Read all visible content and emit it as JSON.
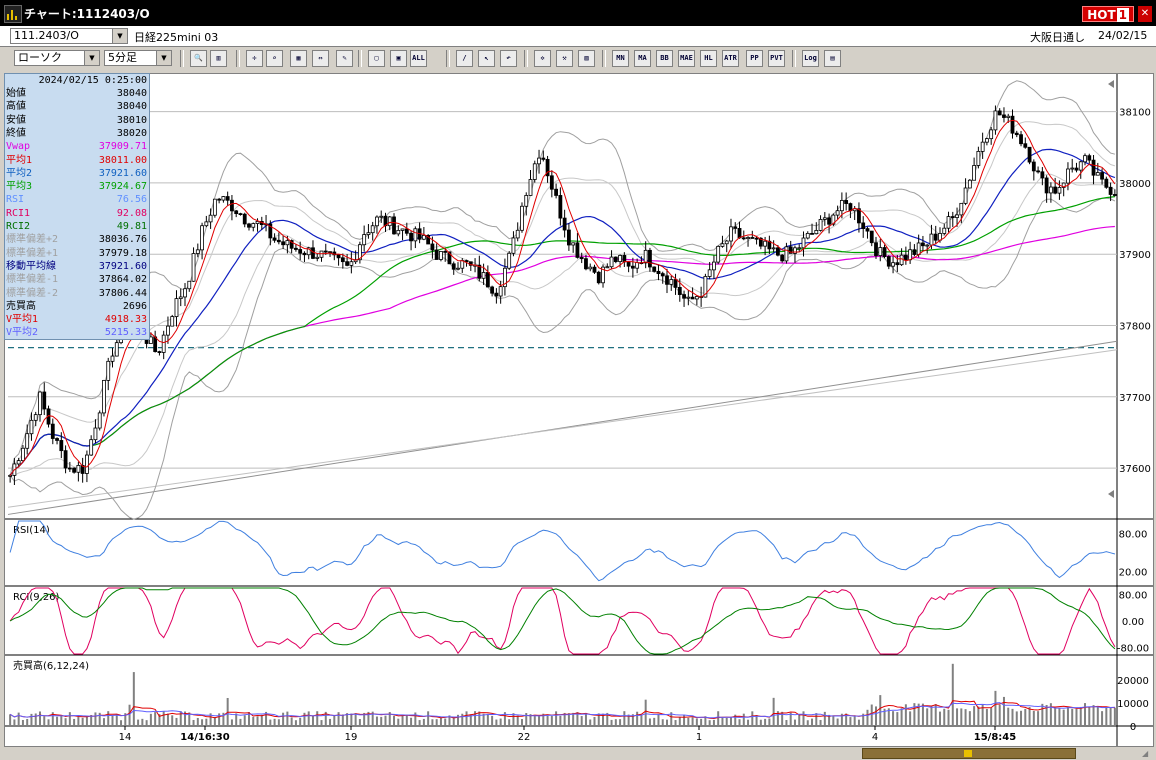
{
  "window": {
    "title": "チャート:1112403/O",
    "hot_label": "HOT",
    "hot_num": "1"
  },
  "header": {
    "symbol_code": "111.2403/O",
    "instrument_name": "日経225mini 03",
    "market": "大阪日通し",
    "date": "24/02/15"
  },
  "toolbar": {
    "chart_type": "ローソク",
    "period": "5分足",
    "buttons": [
      {
        "name": "zoom-icon",
        "glyph": "🔍"
      },
      {
        "name": "split-icon",
        "glyph": "▥"
      },
      {
        "name": "crosshair-icon",
        "glyph": "✛"
      },
      {
        "name": "magnify-icon",
        "glyph": "⌕"
      },
      {
        "name": "chart-icon",
        "glyph": "▦"
      },
      {
        "name": "scroll-icon",
        "glyph": "⇔"
      },
      {
        "name": "pen-icon",
        "glyph": "✎"
      },
      {
        "name": "pointer-icon",
        "glyph": "▢"
      },
      {
        "name": "grid-icon",
        "glyph": "▣"
      },
      {
        "name": "all-icon",
        "glyph": "ALL"
      },
      {
        "name": "pencil-icon",
        "glyph": "/"
      },
      {
        "name": "arrow-icon",
        "glyph": "↖"
      },
      {
        "name": "undo-icon",
        "glyph": "↶"
      },
      {
        "name": "star-icon",
        "glyph": "✲"
      },
      {
        "name": "wrench-icon",
        "glyph": "⚒"
      },
      {
        "name": "color-icon",
        "glyph": "▨"
      },
      {
        "name": "indicator-mn-icon",
        "glyph": "MN"
      },
      {
        "name": "indicator-ma-icon",
        "glyph": "MA"
      },
      {
        "name": "indicator-bb-icon",
        "glyph": "BB"
      },
      {
        "name": "indicator-mae-icon",
        "glyph": "MAE"
      },
      {
        "name": "indicator-hl-icon",
        "glyph": "HL"
      },
      {
        "name": "indicator-atr-icon",
        "glyph": "ATR"
      },
      {
        "name": "indicator-pp-icon",
        "glyph": "PP"
      },
      {
        "name": "indicator-pvt-icon",
        "glyph": "PVT"
      },
      {
        "name": "indicator-log-icon",
        "glyph": "Log"
      },
      {
        "name": "print-icon",
        "glyph": "▤"
      }
    ]
  },
  "info": {
    "datetime": "2024/02/15  0:25:00",
    "rows": [
      {
        "k": "始値",
        "v": "38040",
        "c": "#000000"
      },
      {
        "k": "高値",
        "v": "38040",
        "c": "#000000"
      },
      {
        "k": "安値",
        "v": "38010",
        "c": "#000000"
      },
      {
        "k": "終値",
        "v": "38020",
        "c": "#000000"
      },
      {
        "k": "Vwap",
        "v": "37909.71",
        "c": "#e000e0"
      },
      {
        "k": "平均1",
        "v": "38011.00",
        "c": "#e00000"
      },
      {
        "k": "平均2",
        "v": "37921.60",
        "c": "#1060c0"
      },
      {
        "k": "平均3",
        "v": "37924.67",
        "c": "#00a000"
      },
      {
        "k": "RSI",
        "v": "76.56",
        "c": "#6090ff"
      },
      {
        "k": "RCI1",
        "v": "92.08",
        "c": "#e00060"
      },
      {
        "k": "RCI2",
        "v": "49.81",
        "c": "#007000"
      },
      {
        "k": "標準偏差+2",
        "v": "38036.76",
        "c": "#a0a0a0"
      },
      {
        "k": "標準偏差+1",
        "v": "37979.18",
        "c": "#a0a0a0"
      },
      {
        "k": "移動平均線",
        "v": "37921.60",
        "c": "#000080"
      },
      {
        "k": "標準偏差-1",
        "v": "37864.02",
        "c": "#a0a0a0"
      },
      {
        "k": "標準偏差-2",
        "v": "37806.44",
        "c": "#a0a0a0"
      },
      {
        "k": "売買高",
        "v": "2696",
        "c": "#000000"
      },
      {
        "k": "V平均1",
        "v": "4918.33",
        "c": "#e00000"
      },
      {
        "k": "V平均2",
        "v": "5215.33",
        "c": "#6060ff"
      }
    ]
  },
  "chart_data": {
    "type": "candlestick",
    "price_ticks": [
      "38100",
      "38000",
      "37900",
      "37800",
      "37700",
      "37600"
    ],
    "ylim": [
      37530,
      38150
    ],
    "x_labels": [
      "14",
      "14/16:30",
      "19",
      "22",
      "1",
      "4",
      "15/8:45"
    ],
    "panels": [
      {
        "label": "RSI(14)",
        "ticks": [
          "80.00",
          "20.00"
        ],
        "ylim": [
          0,
          100
        ]
      },
      {
        "label": "RCI(9,26)",
        "ticks": [
          "80.00",
          "0.00",
          "-80.00"
        ],
        "ylim": [
          -100,
          100
        ]
      },
      {
        "label": "売買高(6,12,24)",
        "ticks": [
          "20000",
          "10000",
          "0"
        ],
        "ylim": [
          0,
          30000
        ]
      }
    ],
    "ohlc_anchors": [
      37590,
      37640,
      37700,
      37640,
      37600,
      37600,
      37680,
      37770,
      37800,
      37790,
      37760,
      37820,
      37860,
      37930,
      37980,
      37970,
      37950,
      37940,
      37920,
      37910,
      37905,
      37900,
      37890,
      37880,
      37930,
      37950,
      37940,
      37930,
      37920,
      37900,
      37890,
      37885,
      37870,
      37850,
      37900,
      37990,
      38050,
      37980,
      37920,
      37890,
      37870,
      37895,
      37880,
      37900,
      37880,
      37860,
      37830,
      37850,
      37900,
      37930,
      37920,
      37910,
      37900,
      37900,
      37920,
      37940,
      37960,
      37970,
      37940,
      37900,
      37890,
      37900,
      37910,
      37930,
      37950,
      38000,
      38060,
      38100,
      38080,
      38050,
      38000,
      37990,
      38020,
      38030,
      38000,
      37990
    ],
    "series_colors": {
      "avg1": "#e00000",
      "avg2": "#1020c0",
      "avg3": "#00a000",
      "vwap": "#e000e0",
      "bb": "#a0a0a0",
      "rsi": "#4080e0",
      "rci1": "#e00060",
      "rci2": "#008000",
      "volume": "#808080"
    }
  }
}
